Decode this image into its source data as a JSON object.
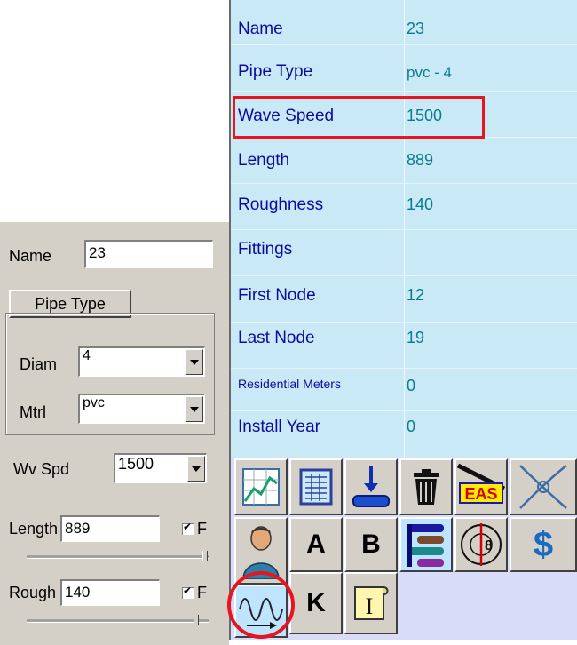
{
  "grid": {
    "rows": [
      {
        "name": "Name",
        "value": "23"
      },
      {
        "name": "Pipe Type",
        "value": "pvc - 4"
      },
      {
        "name": "Wave Speed",
        "value": "1500"
      },
      {
        "name": "Length",
        "value": "889"
      },
      {
        "name": "Roughness",
        "value": "140"
      },
      {
        "name": "Fittings",
        "value": ""
      },
      {
        "name": "First Node",
        "value": "12"
      },
      {
        "name": "Last Node",
        "value": "19"
      },
      {
        "name": "Residential Meters",
        "value": "0"
      },
      {
        "name": "Install Year",
        "value": "0"
      }
    ],
    "highlight_color": "#e8141e"
  },
  "toolbar": {
    "buttons": [
      {
        "icon": "chart-table-icon"
      },
      {
        "icon": "spreadsheet-icon"
      },
      {
        "icon": "pipe-down-icon"
      },
      {
        "icon": "trash-icon"
      },
      {
        "icon": "eas-icon",
        "label": "EAS"
      },
      {
        "icon": "crossed-lines-icon"
      },
      {
        "icon": "user-icon"
      },
      {
        "icon": "letter-a-icon",
        "label": "A"
      },
      {
        "icon": "letter-b-icon",
        "label": "B"
      },
      {
        "icon": "stacked-pipes-icon"
      },
      {
        "icon": "pipe-diameter-icon",
        "label": "8"
      },
      {
        "icon": "dollar-icon",
        "label": "$"
      },
      {
        "icon": "wave-icon"
      },
      {
        "icon": "letter-k-icon",
        "label": "K"
      },
      {
        "icon": "scroll-i-icon",
        "label": "I"
      }
    ]
  },
  "panel": {
    "name_label": "Name",
    "name_value": "23",
    "pipe_type_button": "Pipe Type",
    "diam_label": "Diam",
    "diam_value": "4",
    "mtrl_label": "Mtrl",
    "mtrl_value": "pvc",
    "wvspd_label": "Wv Spd",
    "wvspd_value": "1500",
    "length_label": "Length",
    "length_value": "889",
    "length_check_label": "F",
    "rough_label": "Rough",
    "rough_value": "140",
    "rough_check_label": "F"
  }
}
